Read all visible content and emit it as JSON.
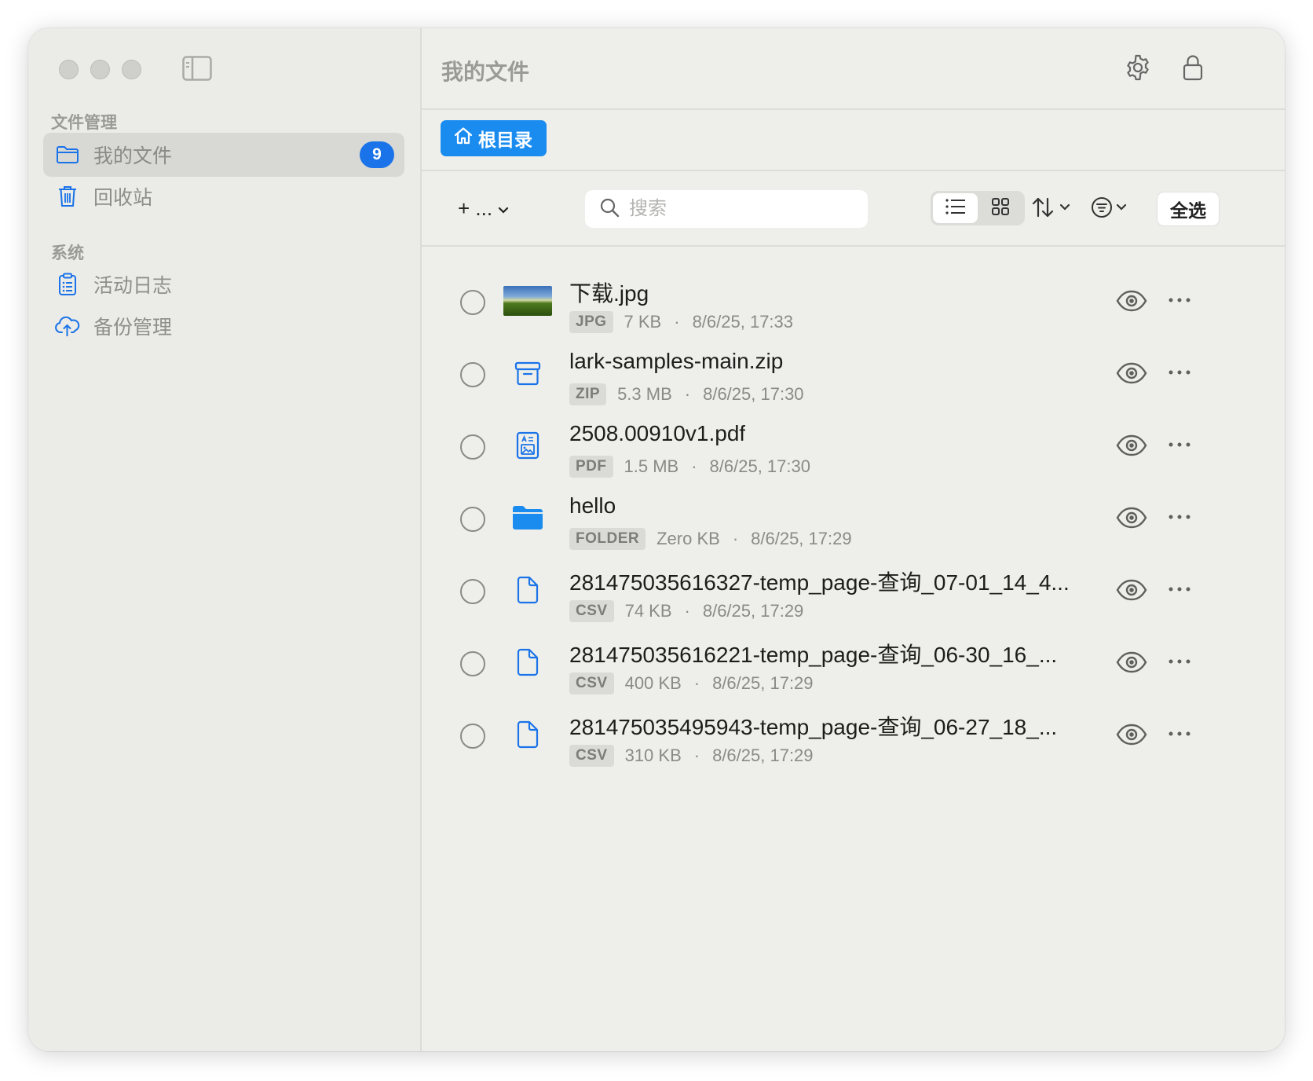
{
  "sidebar": {
    "section_files": "文件管理",
    "section_system": "系统",
    "items": [
      {
        "label": "我的文件",
        "icon": "folder-icon",
        "badge": "9"
      },
      {
        "label": "回收站",
        "icon": "trash-icon"
      },
      {
        "label": "活动日志",
        "icon": "clipboard-icon"
      },
      {
        "label": "备份管理",
        "icon": "cloud-upload-icon"
      }
    ]
  },
  "header": {
    "title": "我的文件"
  },
  "breadcrumb": {
    "root_label": "根目录"
  },
  "toolbar": {
    "add_label": "+ ...",
    "search_placeholder": "搜索",
    "select_all_label": "全选"
  },
  "colors": {
    "accent": "#1a73e8",
    "breadcrumb": "#1a8cf0",
    "window_bg": "#eeefea"
  },
  "files": [
    {
      "name": "下载.jpg",
      "type": "JPG",
      "size": "7 KB",
      "date": "8/6/25, 17:33",
      "icon": "image-thumbnail"
    },
    {
      "name": "lark-samples-main.zip",
      "type": "ZIP",
      "size": "5.3 MB",
      "date": "8/6/25, 17:30",
      "icon": "archive-icon"
    },
    {
      "name": "2508.00910v1.pdf",
      "type": "PDF",
      "size": "1.5 MB",
      "date": "8/6/25, 17:30",
      "icon": "pdf-document-icon"
    },
    {
      "name": "hello",
      "type": "FOLDER",
      "size": "Zero KB",
      "date": "8/6/25, 17:29",
      "icon": "folder-filled-icon"
    },
    {
      "name": "281475035616327-temp_page-查询_07-01_14_4...",
      "type": "CSV",
      "size": "74 KB",
      "date": "8/6/25, 17:29",
      "icon": "document-icon"
    },
    {
      "name": "281475035616221-temp_page-查询_06-30_16_...",
      "type": "CSV",
      "size": "400 KB",
      "date": "8/6/25, 17:29",
      "icon": "document-icon"
    },
    {
      "name": "281475035495943-temp_page-查询_06-27_18_...",
      "type": "CSV",
      "size": "310 KB",
      "date": "8/6/25, 17:29",
      "icon": "document-icon"
    }
  ]
}
